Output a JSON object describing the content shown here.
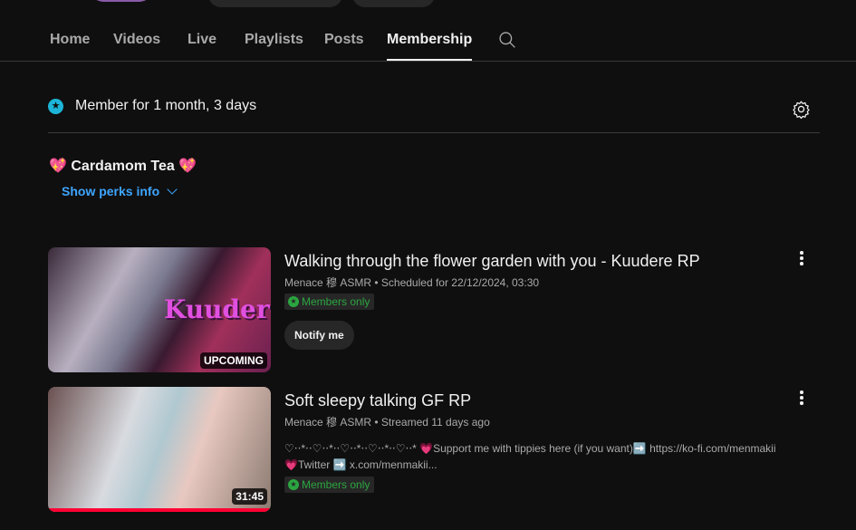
{
  "tabs": [
    {
      "label": "Home"
    },
    {
      "label": "Videos"
    },
    {
      "label": "Live"
    },
    {
      "label": "Playlists"
    },
    {
      "label": "Posts"
    },
    {
      "label": "Membership"
    }
  ],
  "membership": {
    "status": "Member for 1 month, 3 days",
    "tier": "💖 Cardamom Tea 💖",
    "perks_link": "Show perks info"
  },
  "videos": [
    {
      "title": "Walking through the flower garden with you - Kuudere RP",
      "meta": "Menace 穆 ASMR • Scheduled for 22/12/2024, 03:30",
      "badge": "Members only",
      "thumb_text": "Kuudere",
      "overlay": "UPCOMING",
      "button": "Notify me"
    },
    {
      "title": "Soft sleepy talking GF RP",
      "meta": "Menace 穆 ASMR • Streamed 11 days ago",
      "description_line1": "♡‧‧*‧‧♡‧‧*‧‧♡‧‧*‧‧♡‧‧*‧‧♡‧‧* 💗Support me with tippies here (if you want)➡️ https://ko-fi.com/menmakii",
      "description_line2": "💗Twitter ➡️ x.com/menmakii...",
      "badge": "Members only",
      "overlay": "31:45",
      "watched_fraction": 1.0
    }
  ],
  "colors": {
    "accent": "#3ea6ff",
    "member_star": "#1cb5d8",
    "members_only": "#2ba640",
    "progress": "#ff0033"
  }
}
